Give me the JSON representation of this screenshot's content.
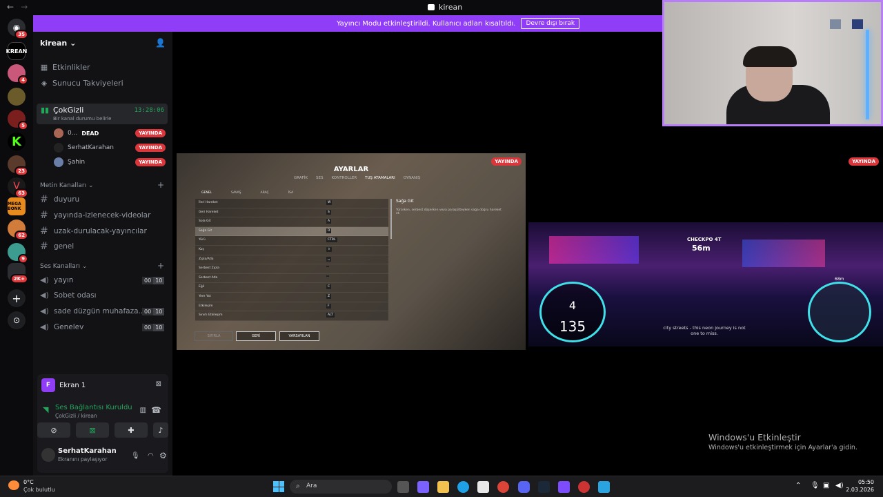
{
  "window": {
    "title": "kirean",
    "back": "←",
    "forward": "→"
  },
  "banner": {
    "text": "Yayıncı Modu etkinleştirildi. Kullanıcı adları kısaltıldı.",
    "button": "Devre dışı bırak"
  },
  "rail": {
    "badges": [
      "35",
      "4",
      "5",
      "23",
      "63",
      "62",
      "9",
      "2K+"
    ]
  },
  "server": {
    "name": "kirean",
    "items": [
      {
        "icon": "calendar-icon",
        "label": "Etkinlikler"
      },
      {
        "icon": "boost-icon",
        "label": "Sunucu Takviyeleri"
      }
    ]
  },
  "voice": {
    "name": "ÇokGizli",
    "status": "Bir kanal durumu belirle",
    "time": "13:28:06",
    "users": [
      {
        "name": "0...",
        "extra": "DEAD",
        "live": "YAYINDA"
      },
      {
        "name": "SerhatKarahan",
        "live": "YAYINDA"
      },
      {
        "name": "Şahin",
        "live": "YAYINDA"
      }
    ]
  },
  "text_cat": "Metin Kanalları",
  "text_channels": [
    "duyuru",
    "yayında-izlenecek-videolar",
    "uzak-durulacak-yayıncılar",
    "genel"
  ],
  "voice_cat": "Ses Kanalları",
  "voice_channels": [
    {
      "name": "yayın",
      "c1": "00",
      "c2": "10"
    },
    {
      "name": "Sobet odası"
    },
    {
      "name": "sade düzgün muhafaza...",
      "c1": "00",
      "c2": "10"
    },
    {
      "name": "Genelev",
      "c1": "00",
      "c2": "10"
    }
  ],
  "panel": {
    "screen": "Ekran 1",
    "screen_letter": "F",
    "conn": "Ses Bağlantısı Kuruldu",
    "conn_sub": "ÇokGizli / kirean",
    "user": "SerhatKarahan",
    "user_status": "Ekranını paylaşıyor"
  },
  "stream1": {
    "live": "YAYINDA",
    "title": "AYARLAR",
    "tabs": [
      "GRAFİK",
      "SES",
      "KONTROLLER",
      "TUŞ ATAMALARI",
      "OYNANIŞ"
    ],
    "subtabs": [
      "GENEL",
      "SAVAŞ",
      "ARAÇ",
      "İSA"
    ],
    "rows": [
      {
        "label": "İleri Hareket",
        "key": "W"
      },
      {
        "label": "Geri Hareket",
        "key": "S"
      },
      {
        "label": "Sola Git",
        "key": "A"
      },
      {
        "label": "Sağa Git",
        "key": "D"
      },
      {
        "label": "Yürü",
        "key": "CTRL"
      },
      {
        "label": "Koş",
        "key": "⇧"
      },
      {
        "label": "Zıpla/Atla",
        "key": "␣"
      },
      {
        "label": "Serbest Zıpla",
        "key": ""
      },
      {
        "label": "Serbest Atla",
        "key": ""
      },
      {
        "label": "Eğil",
        "key": "C"
      },
      {
        "label": "Yere Yat",
        "key": "Z"
      },
      {
        "label": "Etkileşim",
        "key": "F"
      },
      {
        "label": "Sınırlı Etkileşim",
        "key": "ALT"
      }
    ],
    "detail_title": "Sağa Git",
    "detail_text": "Yürürken, serbest düşerken veya paraşütteyken sağa doğru hareket et.",
    "buttons": [
      "SIFIRLA",
      "GERİ",
      "VARSAYILAN"
    ]
  },
  "stream2": {
    "live": "YAYINDA",
    "checkpoint": "CHECKPO 4T",
    "distance": "56m",
    "gear": "4",
    "speed": "135",
    "subtitle": "city streets - this neon journey is not one to miss.",
    "map_dist": "68m"
  },
  "watermark": {
    "line1": "Windows'u Etkinleştir",
    "line2": "Windows'u etkinleştirmek için Ayarlar'a gidin."
  },
  "taskbar": {
    "temp": "0°C",
    "weather": "Çok bulutlu",
    "search": "Ara",
    "time": "05:50",
    "date": "2.03.2026"
  }
}
